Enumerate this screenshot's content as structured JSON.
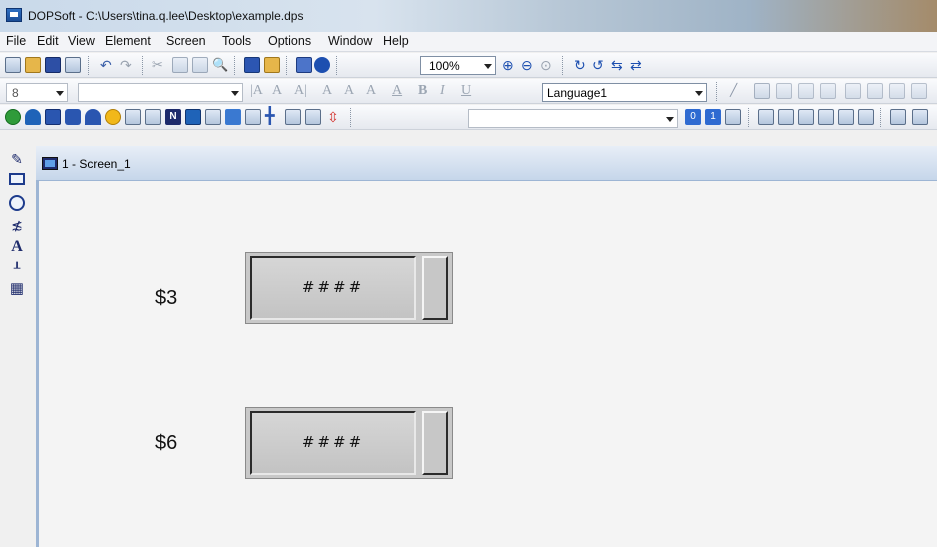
{
  "window": {
    "title": "DOPSoft - C:\\Users\\tina.q.lee\\Desktop\\example.dps"
  },
  "menu": [
    "File",
    "Edit",
    "View",
    "Element",
    "Screen",
    "Tools",
    "Options",
    "Window",
    "Help"
  ],
  "toolbar": {
    "zoom_value": "100%",
    "font_size_value": "8",
    "font_name_value": "",
    "language_value": "Language1",
    "text_state_value": ""
  },
  "screen": {
    "tab_label": "1 - Screen_1",
    "elements": [
      {
        "label": "$3",
        "display": "####"
      },
      {
        "label": "$6",
        "display": "####"
      }
    ]
  }
}
